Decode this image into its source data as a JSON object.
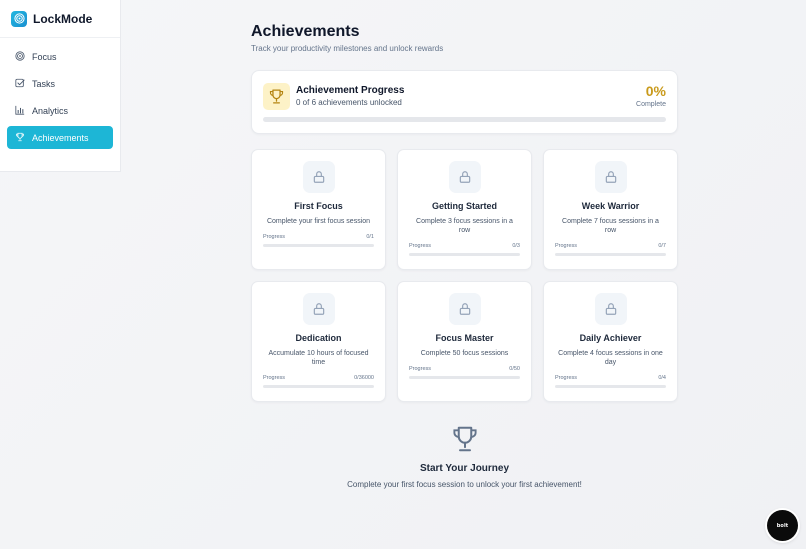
{
  "app": {
    "name": "LockMode",
    "accent": "#1db6d6"
  },
  "sidebar": {
    "items": [
      {
        "label": "Focus",
        "icon": "target-icon",
        "active": false
      },
      {
        "label": "Tasks",
        "icon": "checkbox-icon",
        "active": false
      },
      {
        "label": "Analytics",
        "icon": "bar-chart-icon",
        "active": false
      },
      {
        "label": "Achievements",
        "icon": "trophy-icon",
        "active": true
      }
    ]
  },
  "page": {
    "title": "Achievements",
    "subtitle": "Track your productivity milestones and unlock rewards"
  },
  "progress": {
    "title": "Achievement Progress",
    "summary": "0 of 6 achievements unlocked",
    "percent": "0%",
    "percent_label": "Complete",
    "fraction": 0,
    "color": "#c99a1b"
  },
  "achievements": [
    {
      "title": "First Focus",
      "description": "Complete your first focus session",
      "progress_label": "Progress",
      "progress_value": "0/1",
      "fraction": 0,
      "locked": true
    },
    {
      "title": "Getting Started",
      "description": "Complete 3 focus sessions in a row",
      "progress_label": "Progress",
      "progress_value": "0/3",
      "fraction": 0,
      "locked": true
    },
    {
      "title": "Week Warrior",
      "description": "Complete 7 focus sessions in a row",
      "progress_label": "Progress",
      "progress_value": "0/7",
      "fraction": 0,
      "locked": true
    },
    {
      "title": "Dedication",
      "description": "Accumulate 10 hours of focused time",
      "progress_label": "Progress",
      "progress_value": "0/36000",
      "fraction": 0,
      "locked": true
    },
    {
      "title": "Focus Master",
      "description": "Complete 50 focus sessions",
      "progress_label": "Progress",
      "progress_value": "0/50",
      "fraction": 0,
      "locked": true
    },
    {
      "title": "Daily Achiever",
      "description": "Complete 4 focus sessions in one day",
      "progress_label": "Progress",
      "progress_value": "0/4",
      "fraction": 0,
      "locked": true
    }
  ],
  "journey": {
    "title": "Start Your Journey",
    "subtitle": "Complete your first focus session to unlock your first achievement!"
  },
  "fab": {
    "label": "bolt"
  }
}
